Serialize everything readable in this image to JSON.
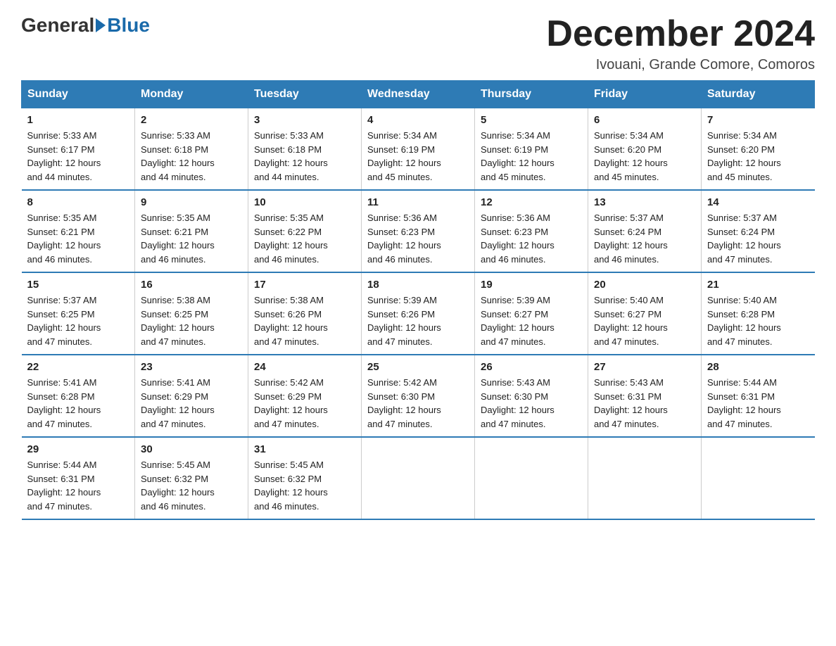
{
  "header": {
    "logo_general": "General",
    "logo_blue": "Blue",
    "month_title": "December 2024",
    "location": "Ivouani, Grande Comore, Comoros"
  },
  "weekdays": [
    "Sunday",
    "Monday",
    "Tuesday",
    "Wednesday",
    "Thursday",
    "Friday",
    "Saturday"
  ],
  "weeks": [
    [
      {
        "day": "1",
        "sunrise": "5:33 AM",
        "sunset": "6:17 PM",
        "daylight": "12 hours and 44 minutes."
      },
      {
        "day": "2",
        "sunrise": "5:33 AM",
        "sunset": "6:18 PM",
        "daylight": "12 hours and 44 minutes."
      },
      {
        "day": "3",
        "sunrise": "5:33 AM",
        "sunset": "6:18 PM",
        "daylight": "12 hours and 44 minutes."
      },
      {
        "day": "4",
        "sunrise": "5:34 AM",
        "sunset": "6:19 PM",
        "daylight": "12 hours and 45 minutes."
      },
      {
        "day": "5",
        "sunrise": "5:34 AM",
        "sunset": "6:19 PM",
        "daylight": "12 hours and 45 minutes."
      },
      {
        "day": "6",
        "sunrise": "5:34 AM",
        "sunset": "6:20 PM",
        "daylight": "12 hours and 45 minutes."
      },
      {
        "day": "7",
        "sunrise": "5:34 AM",
        "sunset": "6:20 PM",
        "daylight": "12 hours and 45 minutes."
      }
    ],
    [
      {
        "day": "8",
        "sunrise": "5:35 AM",
        "sunset": "6:21 PM",
        "daylight": "12 hours and 46 minutes."
      },
      {
        "day": "9",
        "sunrise": "5:35 AM",
        "sunset": "6:21 PM",
        "daylight": "12 hours and 46 minutes."
      },
      {
        "day": "10",
        "sunrise": "5:35 AM",
        "sunset": "6:22 PM",
        "daylight": "12 hours and 46 minutes."
      },
      {
        "day": "11",
        "sunrise": "5:36 AM",
        "sunset": "6:23 PM",
        "daylight": "12 hours and 46 minutes."
      },
      {
        "day": "12",
        "sunrise": "5:36 AM",
        "sunset": "6:23 PM",
        "daylight": "12 hours and 46 minutes."
      },
      {
        "day": "13",
        "sunrise": "5:37 AM",
        "sunset": "6:24 PM",
        "daylight": "12 hours and 46 minutes."
      },
      {
        "day": "14",
        "sunrise": "5:37 AM",
        "sunset": "6:24 PM",
        "daylight": "12 hours and 47 minutes."
      }
    ],
    [
      {
        "day": "15",
        "sunrise": "5:37 AM",
        "sunset": "6:25 PM",
        "daylight": "12 hours and 47 minutes."
      },
      {
        "day": "16",
        "sunrise": "5:38 AM",
        "sunset": "6:25 PM",
        "daylight": "12 hours and 47 minutes."
      },
      {
        "day": "17",
        "sunrise": "5:38 AM",
        "sunset": "6:26 PM",
        "daylight": "12 hours and 47 minutes."
      },
      {
        "day": "18",
        "sunrise": "5:39 AM",
        "sunset": "6:26 PM",
        "daylight": "12 hours and 47 minutes."
      },
      {
        "day": "19",
        "sunrise": "5:39 AM",
        "sunset": "6:27 PM",
        "daylight": "12 hours and 47 minutes."
      },
      {
        "day": "20",
        "sunrise": "5:40 AM",
        "sunset": "6:27 PM",
        "daylight": "12 hours and 47 minutes."
      },
      {
        "day": "21",
        "sunrise": "5:40 AM",
        "sunset": "6:28 PM",
        "daylight": "12 hours and 47 minutes."
      }
    ],
    [
      {
        "day": "22",
        "sunrise": "5:41 AM",
        "sunset": "6:28 PM",
        "daylight": "12 hours and 47 minutes."
      },
      {
        "day": "23",
        "sunrise": "5:41 AM",
        "sunset": "6:29 PM",
        "daylight": "12 hours and 47 minutes."
      },
      {
        "day": "24",
        "sunrise": "5:42 AM",
        "sunset": "6:29 PM",
        "daylight": "12 hours and 47 minutes."
      },
      {
        "day": "25",
        "sunrise": "5:42 AM",
        "sunset": "6:30 PM",
        "daylight": "12 hours and 47 minutes."
      },
      {
        "day": "26",
        "sunrise": "5:43 AM",
        "sunset": "6:30 PM",
        "daylight": "12 hours and 47 minutes."
      },
      {
        "day": "27",
        "sunrise": "5:43 AM",
        "sunset": "6:31 PM",
        "daylight": "12 hours and 47 minutes."
      },
      {
        "day": "28",
        "sunrise": "5:44 AM",
        "sunset": "6:31 PM",
        "daylight": "12 hours and 47 minutes."
      }
    ],
    [
      {
        "day": "29",
        "sunrise": "5:44 AM",
        "sunset": "6:31 PM",
        "daylight": "12 hours and 47 minutes."
      },
      {
        "day": "30",
        "sunrise": "5:45 AM",
        "sunset": "6:32 PM",
        "daylight": "12 hours and 46 minutes."
      },
      {
        "day": "31",
        "sunrise": "5:45 AM",
        "sunset": "6:32 PM",
        "daylight": "12 hours and 46 minutes."
      },
      null,
      null,
      null,
      null
    ]
  ],
  "labels": {
    "sunrise": "Sunrise:",
    "sunset": "Sunset:",
    "daylight": "Daylight:"
  }
}
